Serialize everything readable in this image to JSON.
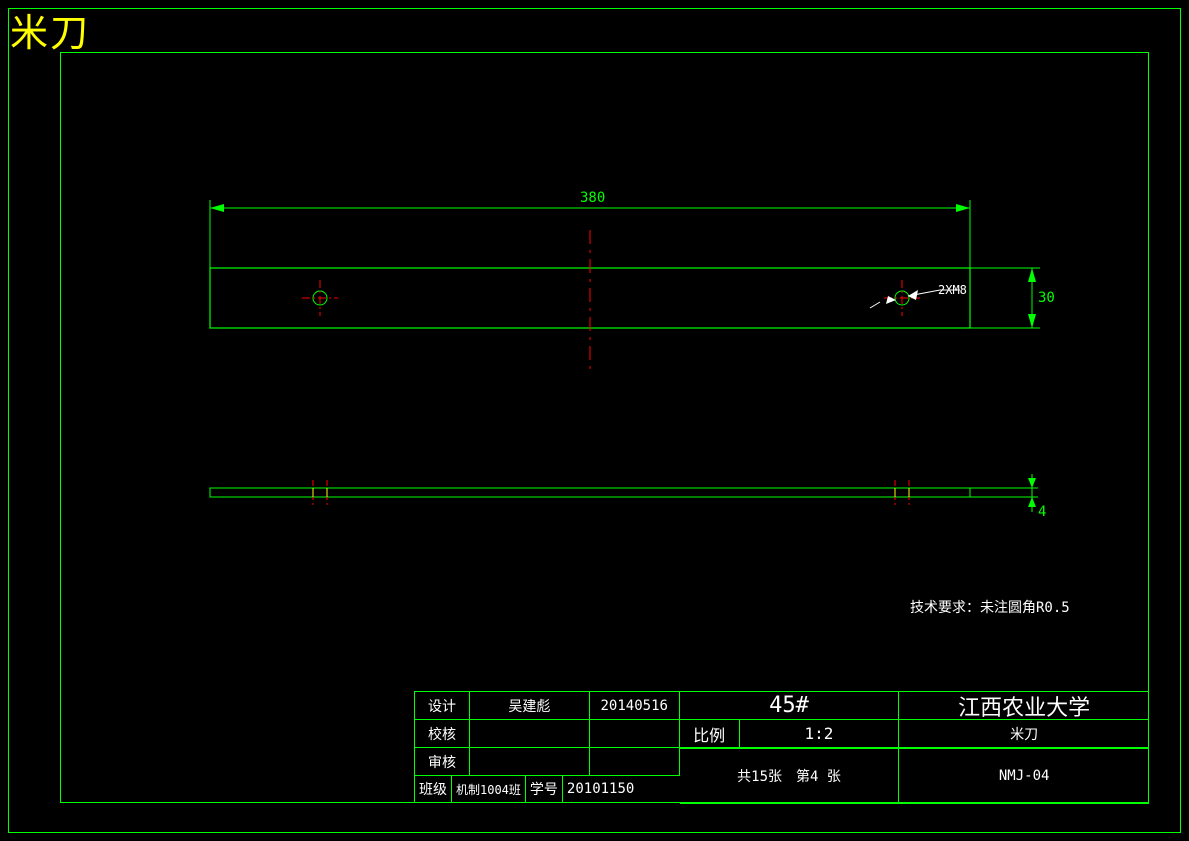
{
  "page_title": "米刀",
  "dimensions": {
    "length": "380",
    "height": "30",
    "thickness": "4",
    "hole_spec": "2XM8"
  },
  "tech_note": "技术要求：未注圆角R0.5",
  "titleblock": {
    "r1": {
      "design_label": "设计",
      "designer": "吴建彪",
      "date": "20140516",
      "material": "45#",
      "school": "江西农业大学"
    },
    "r2": {
      "check_label": "校核",
      "checker": "",
      "check_date": "",
      "scale_label": "比例",
      "scale": "1:2",
      "part_name": "米刀"
    },
    "r3": {
      "review_label": "审核",
      "reviewer": "",
      "review_date": "",
      "sheets": "共15张　第4 张",
      "drawing_no": "NMJ-04"
    },
    "r4": {
      "class_label": "班级",
      "class_value": "机制1004班",
      "id_label": "学号",
      "student_id": "20101150"
    }
  }
}
